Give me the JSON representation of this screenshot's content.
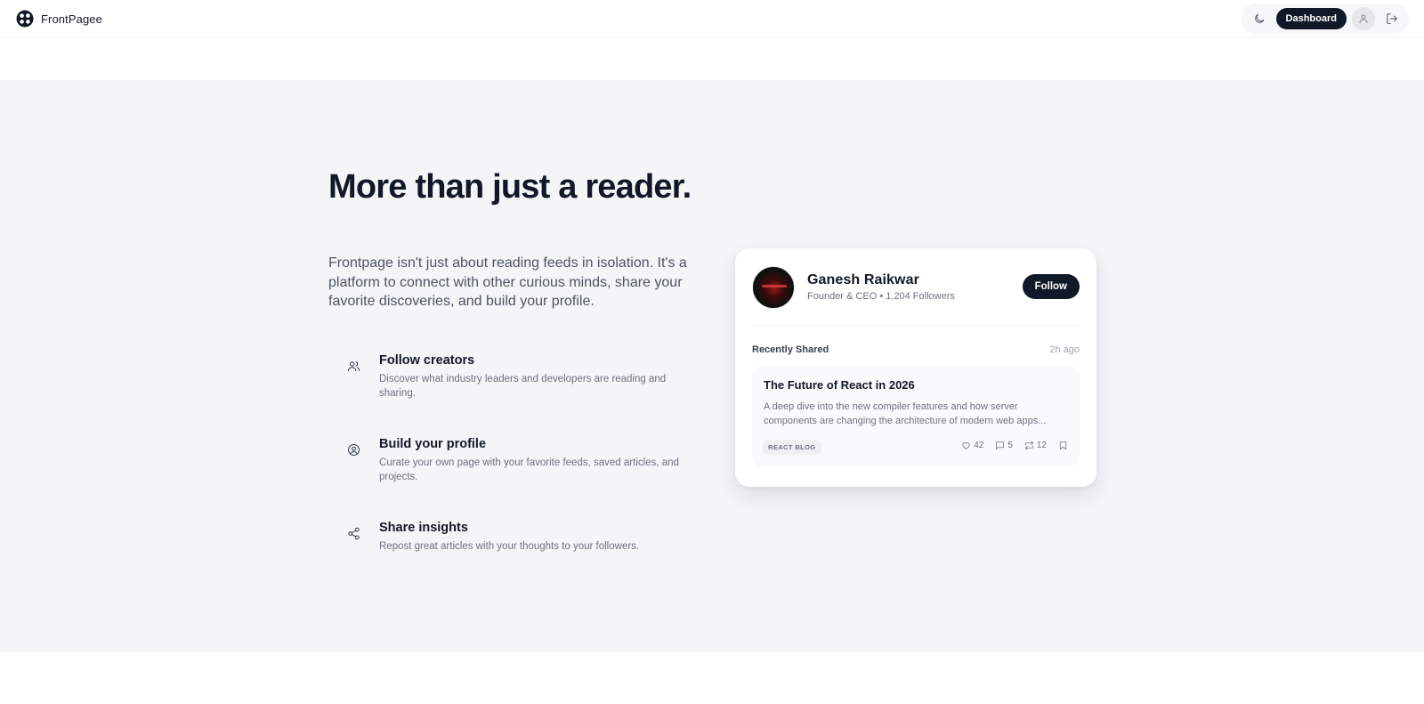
{
  "header": {
    "brand_name": "FrontPagee",
    "logo_icon": "frontpagee-logo",
    "theme_icon": "moon-icon",
    "dashboard_label": "Dashboard",
    "user_icon": "user-icon",
    "logout_icon": "logout-icon"
  },
  "hero": {
    "title": "More than just a reader.",
    "subtitle": "Frontpage isn't just about reading feeds in isolation. It's a platform to connect with other curious minds, share your favorite discoveries, and build your profile."
  },
  "features": [
    {
      "icon": "users-icon",
      "title": "Follow creators",
      "description": "Discover what industry leaders and developers are reading and sharing."
    },
    {
      "icon": "user-circle-icon",
      "title": "Build your profile",
      "description": "Curate your own page with your favorite feeds, saved articles, and projects."
    },
    {
      "icon": "share-icon",
      "title": "Share insights",
      "description": "Repost great articles with your thoughts to your followers."
    }
  ],
  "profile_card": {
    "name": "Ganesh Raikwar",
    "meta": "Founder & CEO • 1,204 Followers",
    "follow_label": "Follow",
    "recently_shared_label": "Recently Shared",
    "recently_shared_time": "2h ago",
    "article": {
      "title": "The Future of React in 2026",
      "description": "A deep dive into the new compiler features and how server components are changing the architecture of modern web apps...",
      "tag": "REACT BLOG",
      "likes": "42",
      "comments": "5",
      "reposts": "12"
    }
  },
  "colors": {
    "accent": "#111827",
    "band_background": "#f4f5f7",
    "muted_text": "#6b7280"
  }
}
